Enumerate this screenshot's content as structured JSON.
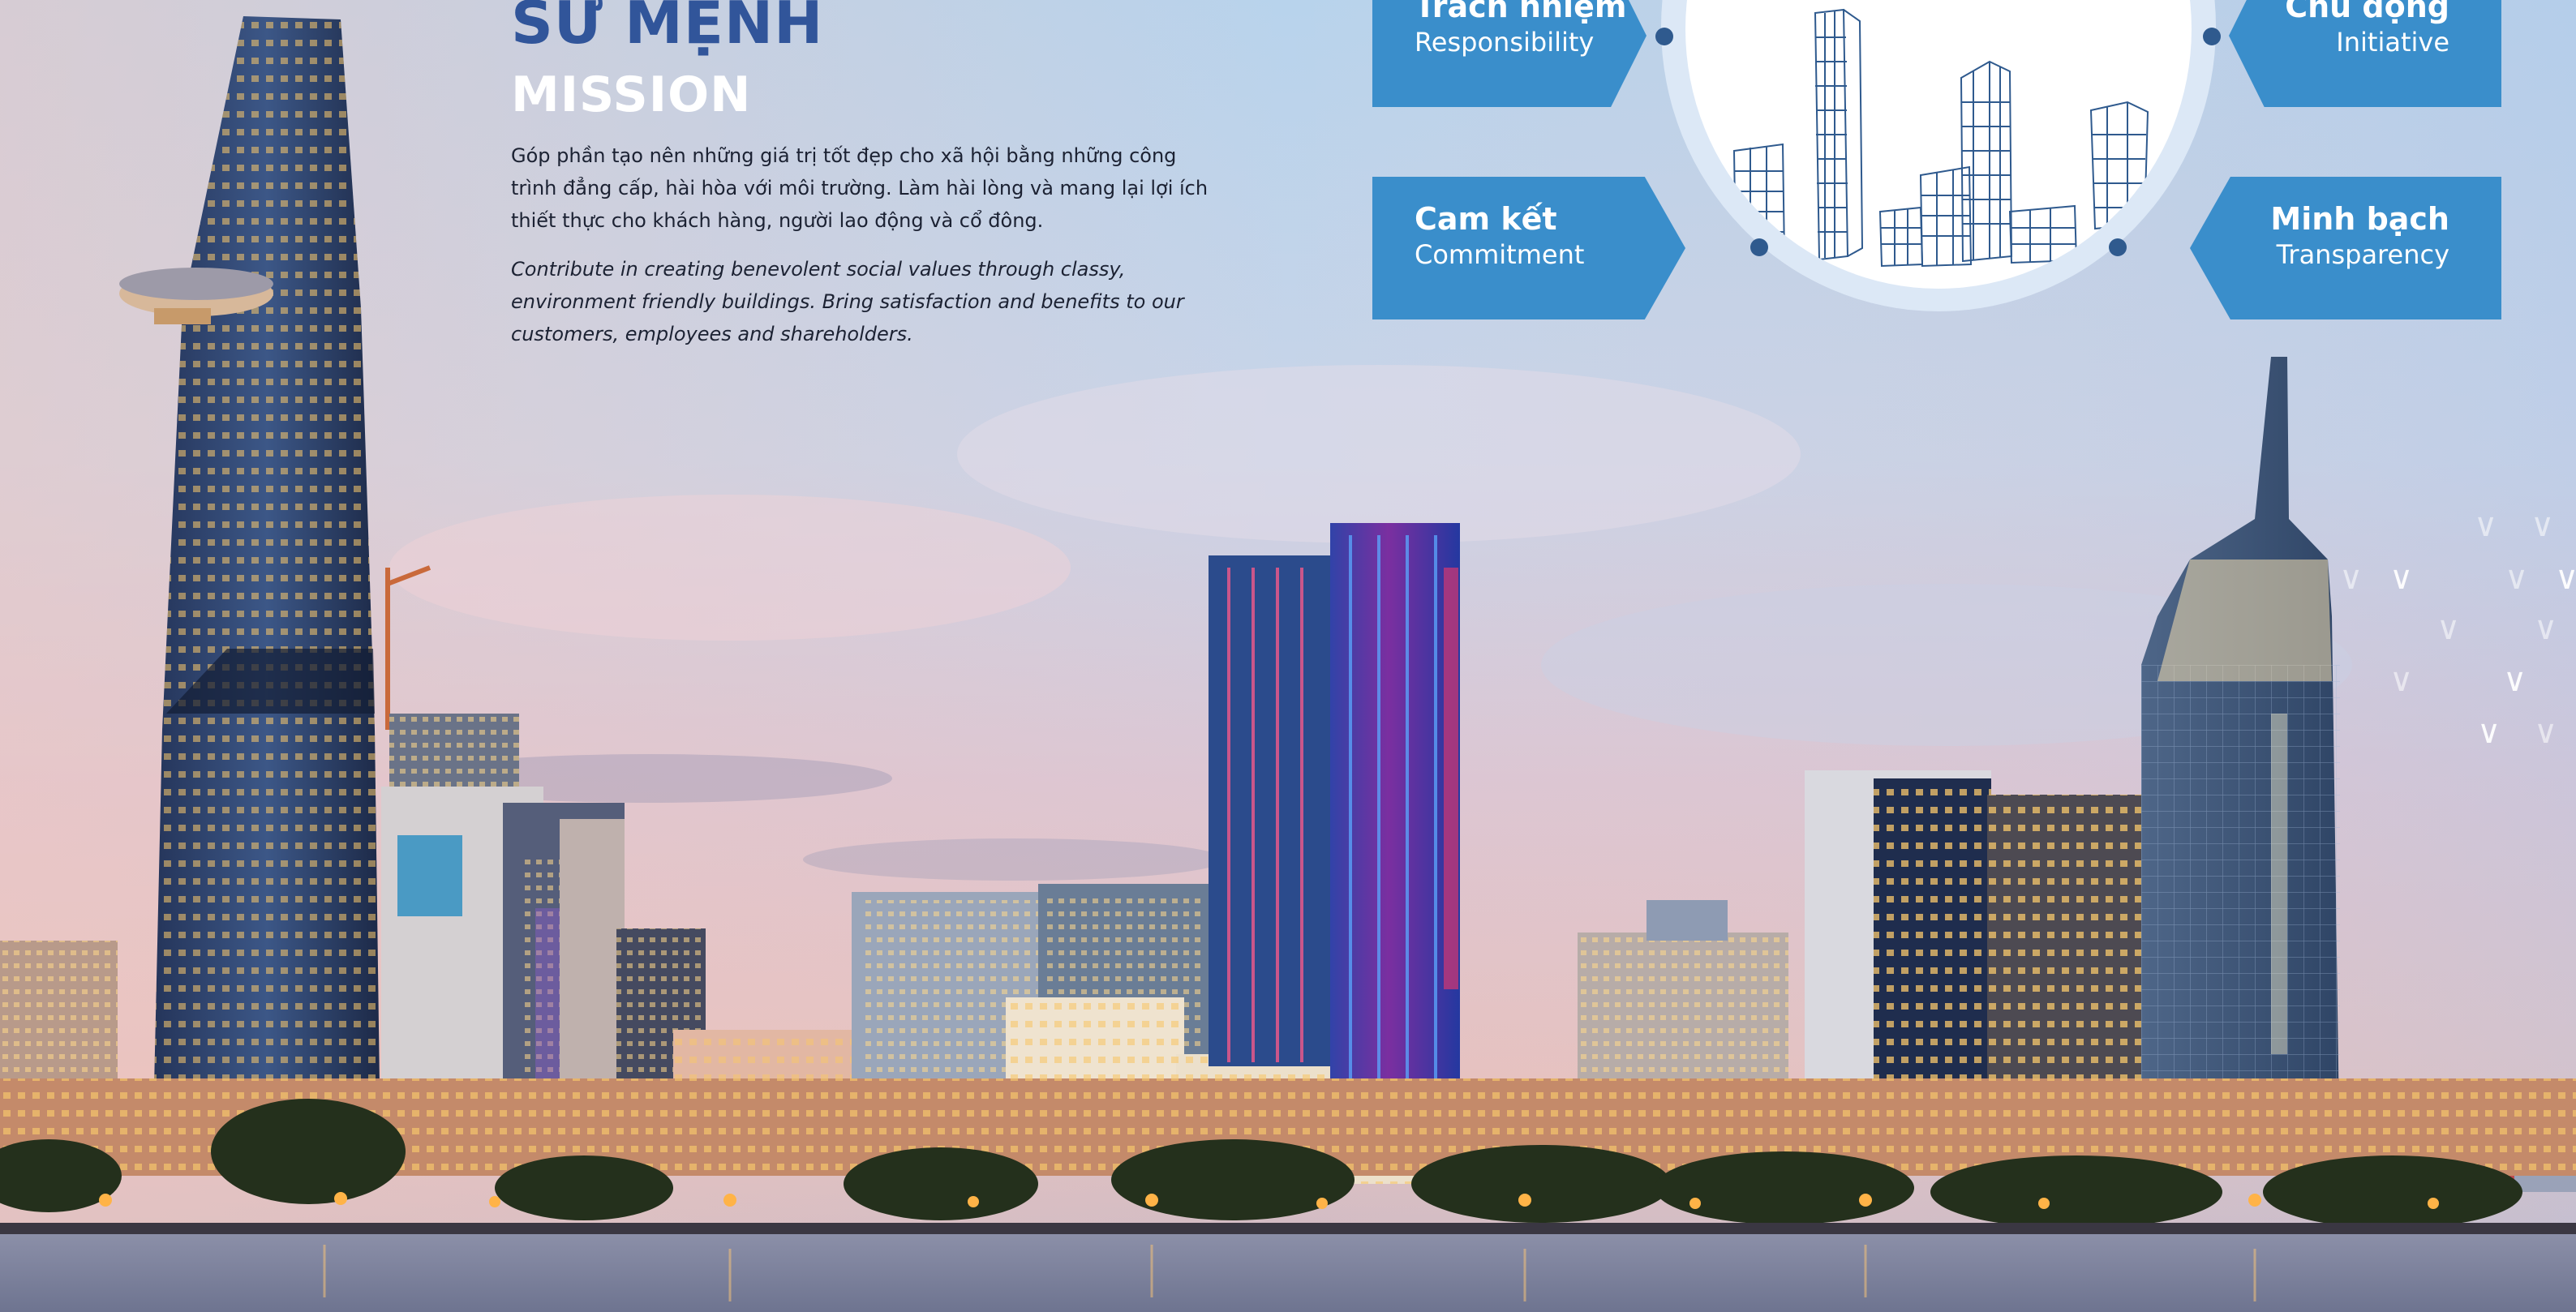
{
  "mission": {
    "title_vi": "SỨ MỆNH",
    "title_en": "MISSION",
    "text_vi": "Góp phần tạo nên những giá trị tốt đẹp cho xã hội bằng những công trình đẳng cấp, hài hòa với môi trường. Làm hài lòng và mang lại lợi ích thiết thực cho khách hàng, người lao động và cổ đông.",
    "text_en": "Contribute in creating benevolent social values through classy, environment friendly buildings. Bring satisfaction and benefits to our customers, employees and shareholders."
  },
  "values": {
    "responsibility": {
      "vi": "Trách nhiệm",
      "en": "Responsibility"
    },
    "commitment": {
      "vi": "Cam kết",
      "en": "Commitment"
    },
    "initiative": {
      "vi": "Chủ động",
      "en": "Initiative"
    },
    "transparency": {
      "vi": "Minh bạch",
      "en": "Transparency"
    }
  },
  "colors": {
    "accent_blue": "#3a8ecb",
    "title_blue": "#31559a",
    "dot_blue": "#2f5a8e"
  },
  "icons": {
    "emblem": "building-sketch-icon",
    "decoration": "chevron-pattern-icon"
  }
}
